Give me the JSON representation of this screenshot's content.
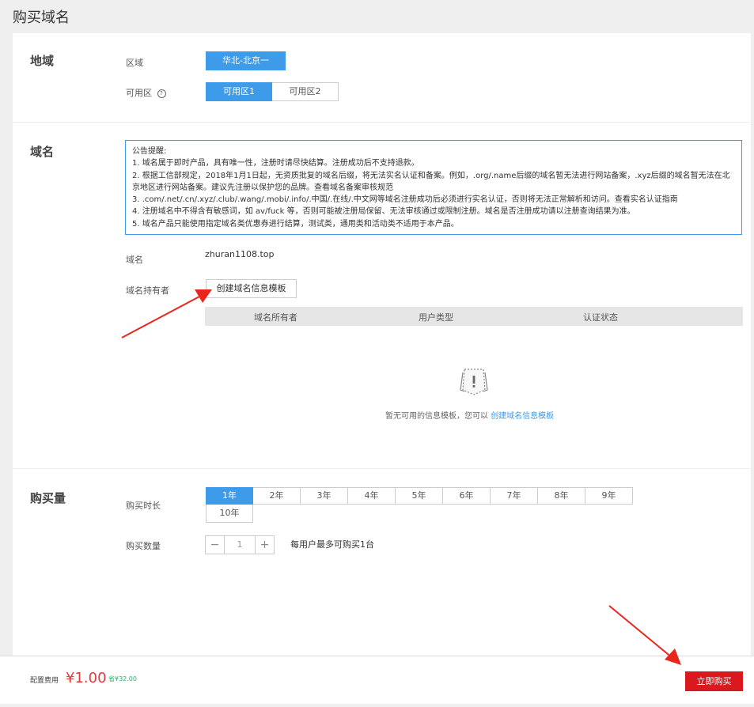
{
  "page": {
    "title": "购买域名"
  },
  "region": {
    "section_title": "地域",
    "region_label": "区域",
    "region_value": "华北-北京一",
    "zone_label": "可用区",
    "zones": [
      "可用区1",
      "可用区2"
    ],
    "selected_zone": "可用区1"
  },
  "domain": {
    "section_title": "域名",
    "notice": [
      "公告提醒:",
      "1. 域名属于即时产品，具有唯一性，注册时请尽快结算。注册成功后不支持退款。",
      "2. 根据工信部规定，2018年1月1日起，无资质批复的域名后缀，将无法实名认证和备案。例如，.org/.name后缀的域名暂无法进行网站备案，.xyz后缀的域名暂无法在北京地区进行网站备案。建议先注册以保护您的品牌。查看域名备案审核规范",
      "3. .com/.net/.cn/.xyz/.club/.wang/.mobi/.info/.中国/.在线/.中文网等域名注册成功后必须进行实名认证，否则将无法正常解析和访问。查看实名认证指南",
      "4. 注册域名中不得含有敏感词，如 av/fuck 等，否则可能被注册局保留、无法审核通过或限制注册。域名是否注册成功请以注册查询结果为准。",
      "5. 域名产品只能使用指定域名类优惠券进行结算，测试类，通用类和活动类不适用于本产品。"
    ],
    "domain_label": "域名",
    "domain_value": "zhuran1108.top",
    "holder_label": "域名持有者",
    "create_template_button": "创建域名信息模板",
    "table_headers": [
      "域名所有者",
      "用户类型",
      "认证状态"
    ],
    "empty_text": "暂无可用的信息模板，您可以",
    "empty_link": "创建域名信息模板"
  },
  "quantity": {
    "section_title": "购买量",
    "duration_label": "购买时长",
    "durations": [
      "1年",
      "2年",
      "3年",
      "4年",
      "5年",
      "6年",
      "7年",
      "8年",
      "9年",
      "10年"
    ],
    "selected_duration": "1年",
    "count_label": "购买数量",
    "count_minus": "−",
    "count_value": "1",
    "count_plus": "+",
    "count_hint": "每用户最多可购买1台"
  },
  "footer": {
    "price_label": "配置费用",
    "price": "¥1.00",
    "save_text": "省¥32.00",
    "buy_button": "立即购买"
  },
  "colors": {
    "accent": "#3d9bea",
    "buy": "#d9191e",
    "price": "#e4393c",
    "annotation_arrow": "#e8261c"
  }
}
